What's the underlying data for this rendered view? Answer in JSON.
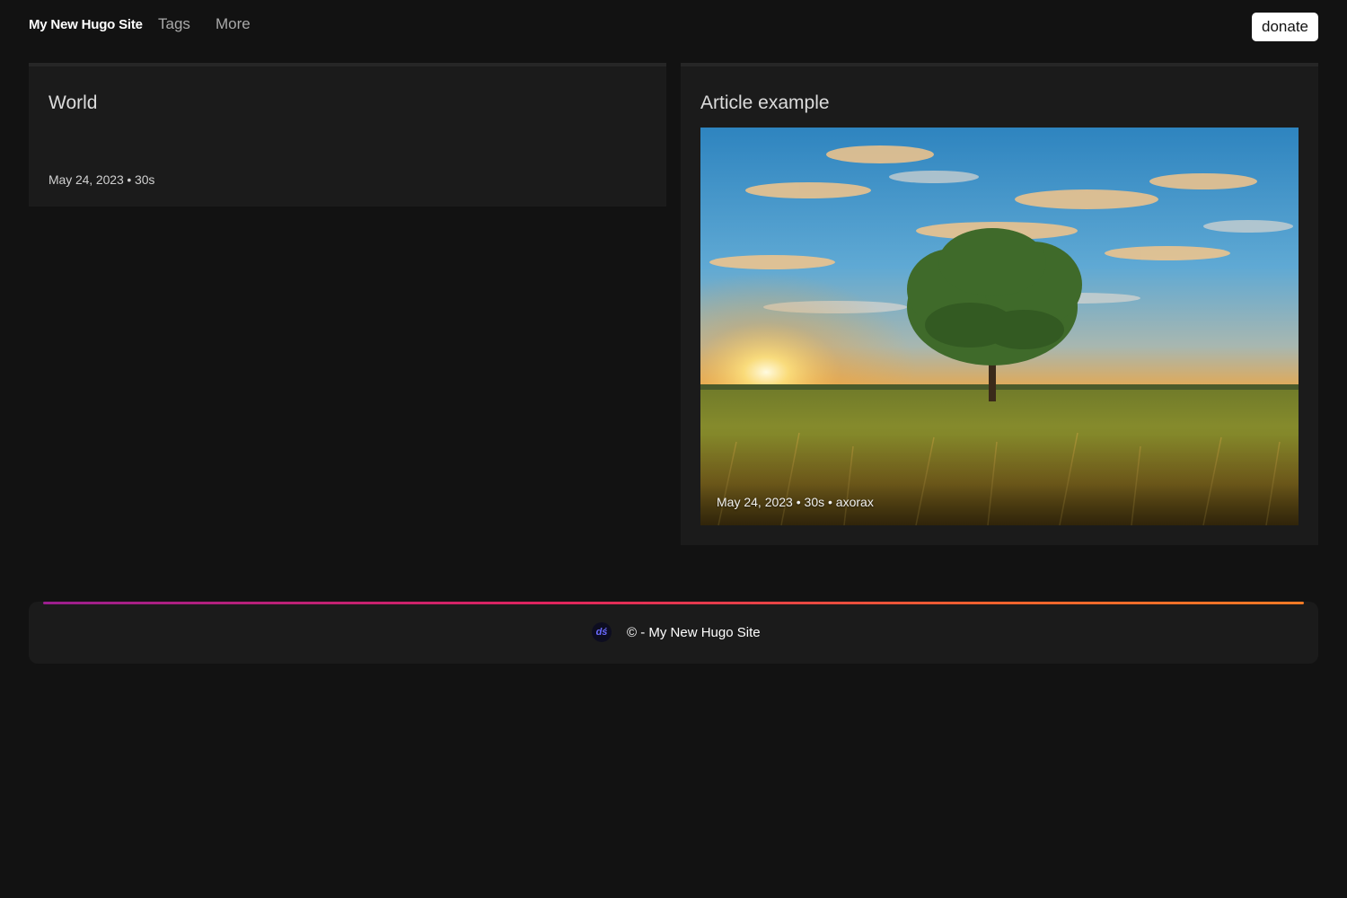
{
  "nav": {
    "brand": "My New Hugo Site",
    "links": [
      "Tags",
      "More"
    ],
    "donate_label": "donate"
  },
  "posts": [
    {
      "title": "World",
      "date": "May 24, 2023",
      "read_time": "30s"
    },
    {
      "title": "Article example",
      "date": "May 24, 2023",
      "read_time": "30s",
      "author": "axorax"
    }
  ],
  "meta_separator": " • ",
  "footer": {
    "logo_icon": "brand-logo-icon",
    "logo_glyph": "dś",
    "text": "© - My New Hugo Site"
  },
  "colors": {
    "background": "#121212",
    "card": "#1b1b1b",
    "donate_bg": "#ffffff",
    "footer_gradient": [
      "#9b1f8e",
      "#e0245e",
      "#f0622e",
      "#f57a25"
    ]
  }
}
